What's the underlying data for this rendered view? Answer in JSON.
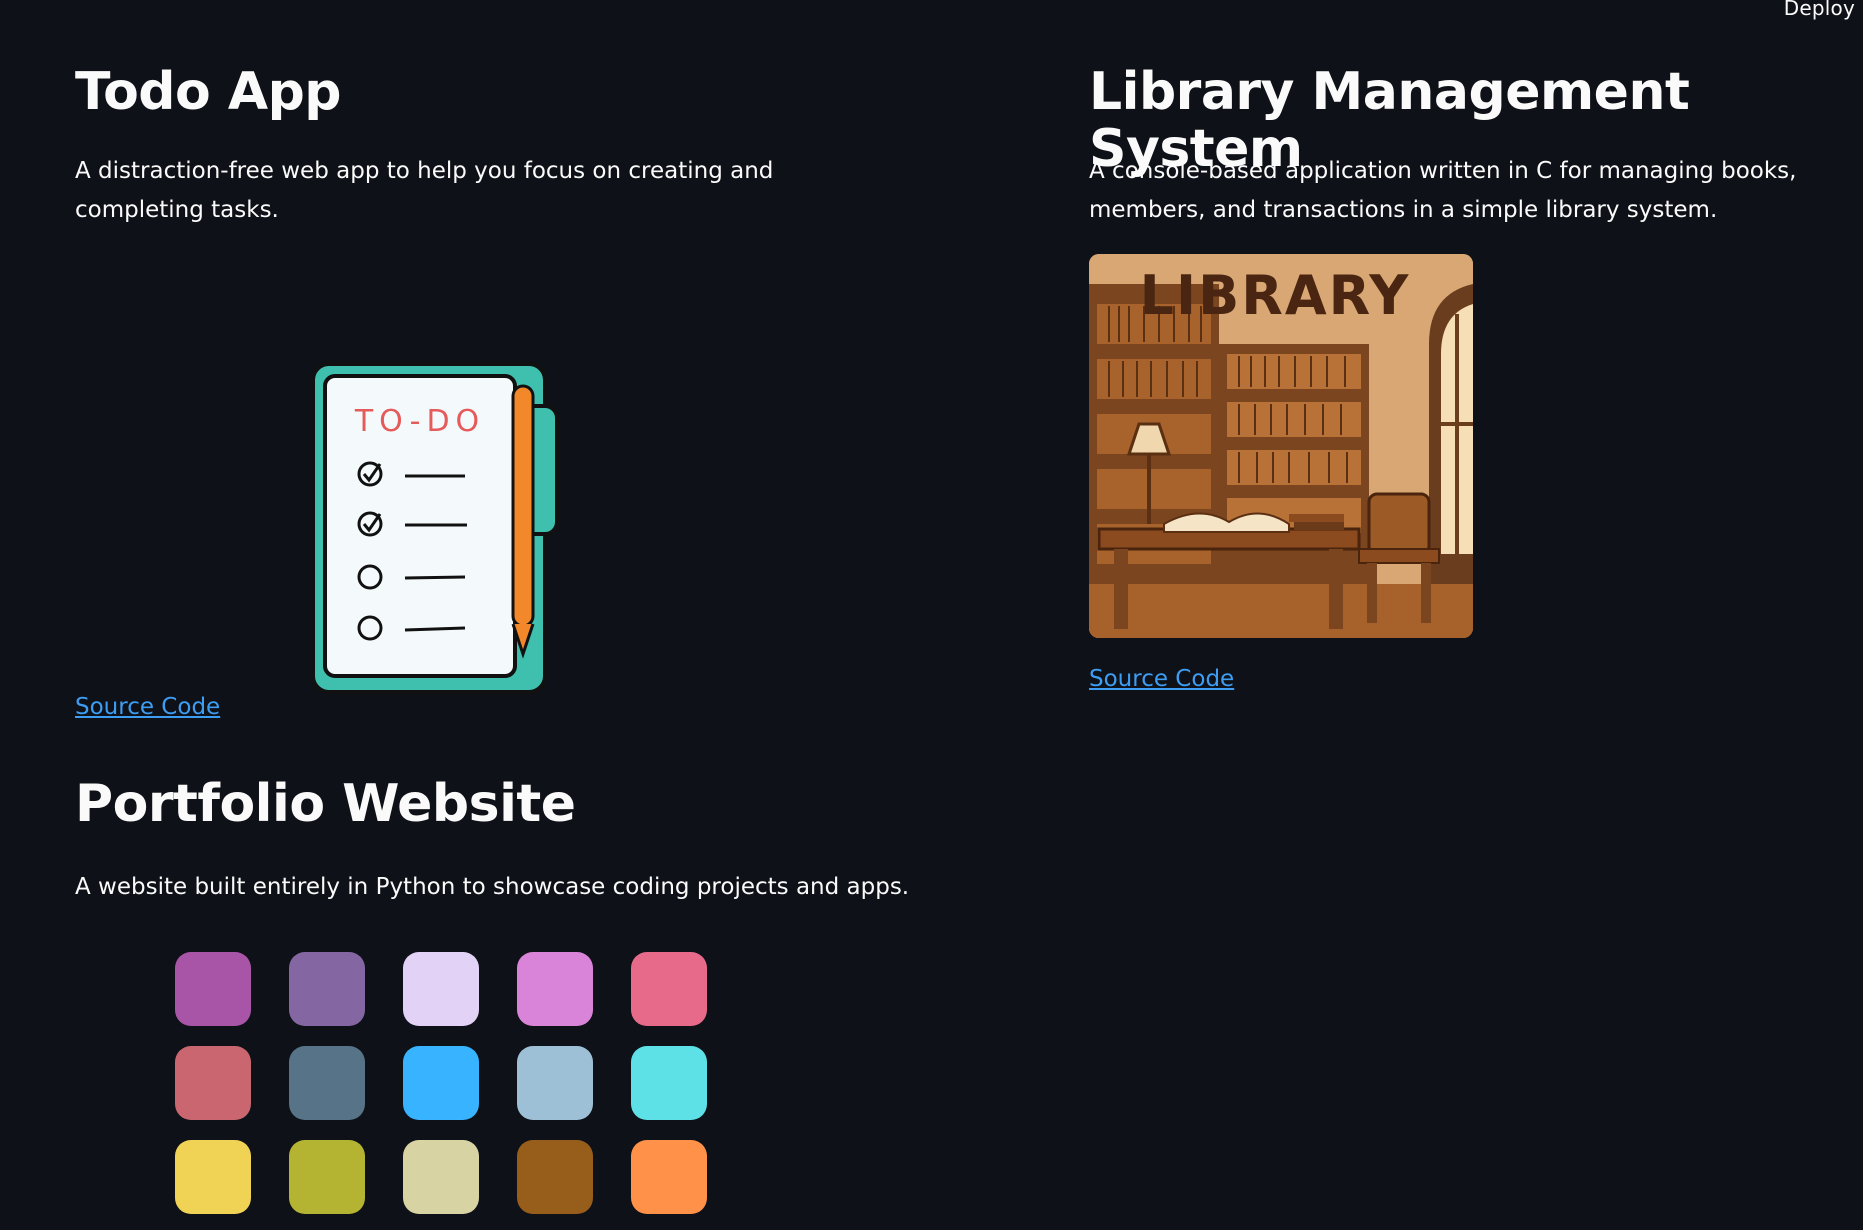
{
  "header": {
    "deploy_label": "Deploy"
  },
  "projects": [
    {
      "title": "Todo App",
      "description": "A distraction-free web app to help you focus on creating and completing tasks.",
      "link_label": "Source Code",
      "image": {
        "heading": "TO-DO"
      }
    },
    {
      "title": "Library Management System",
      "description": "A console-based application written in C for managing books, members, and transactions in a simple library system.",
      "link_label": "Source Code",
      "image": {
        "heading": "LIBRARY"
      }
    },
    {
      "title": "Portfolio Website",
      "description": "A website built entirely in Python to showcase coding projects and apps.",
      "swatches": [
        "#a855a8",
        "#8467a2",
        "#e2d2f5",
        "#d984d8",
        "#e86a8a",
        "#c96670",
        "#567387",
        "#37b3ff",
        "#9ec0d6",
        "#5de1e6",
        "#f0d255",
        "#b4b432",
        "#d8d3a3",
        "#975d1b",
        "#ff9148"
      ]
    }
  ],
  "colors": {
    "background": "#0e1117",
    "text": "#fafafa",
    "link": "#3d9df3"
  }
}
